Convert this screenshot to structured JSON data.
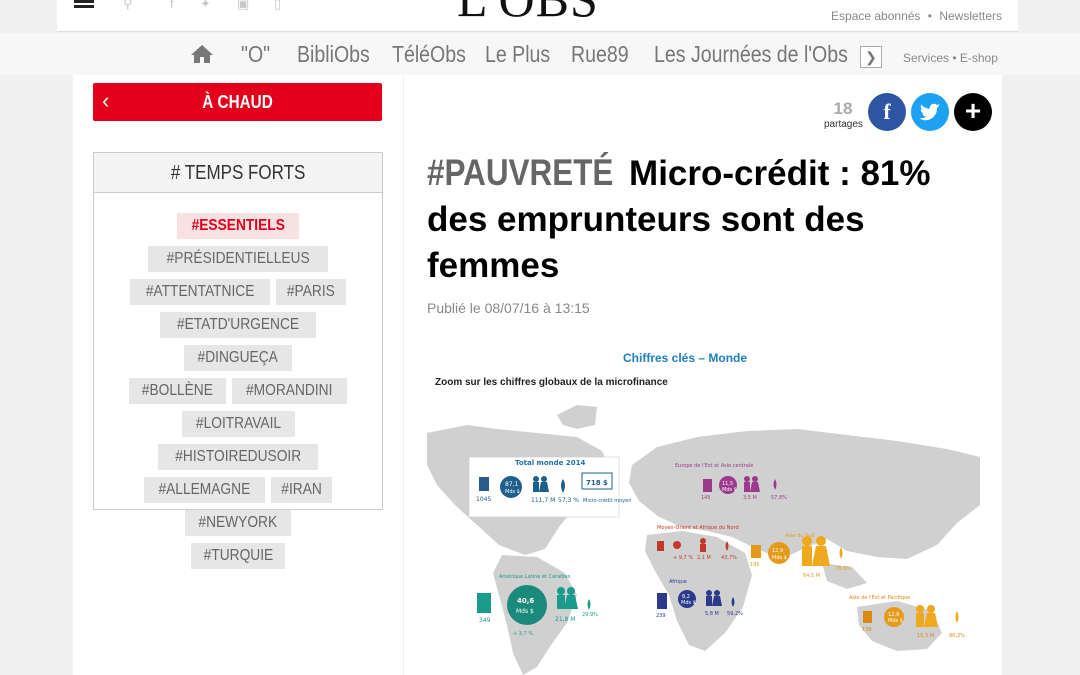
{
  "header": {
    "logo": "L'OBS",
    "links": [
      "Espace abonnés",
      "Newsletters"
    ],
    "dot": "•"
  },
  "nav": {
    "items": [
      "\"O\"",
      "BibliObs",
      "TéléObs",
      "Le Plus",
      "Rue89",
      "Les Journées de l'Obs"
    ],
    "services": "Services • E-shop"
  },
  "sidebar": {
    "hot_label": "À CHAUD",
    "temps_forts_title": "# TEMPS FORTS",
    "tags": [
      "#ESSENTIELS",
      "#PRÉSIDENTIELLEUS",
      "#ATTENTATNICE",
      "#PARIS",
      "#ETATD'URGENCE",
      "#DINGUEÇA",
      "#BOLLÈNE",
      "#MORANDINI",
      "#LOITRAVAIL",
      "#HISTOIREDUSOIR",
      "#ALLEMAGNE",
      "#IRAN",
      "#NEWYORK",
      "#TURQUIE"
    ]
  },
  "article": {
    "share_count": "18",
    "share_label": "partages",
    "category": "#PAUVRETÉ",
    "title": "Micro-crédit : 81% des emprunteurs sont des femmes",
    "published": "Publié le 08/07/16 à 13:15"
  },
  "infographic": {
    "title": "Chiffres clés – Monde",
    "subtitle": "Zoom sur les chiffres globaux de la microfinance",
    "world": {
      "label": "Total monde 2014",
      "amount": "87,1",
      "unit": "Mds $",
      "borrowers": "111,7 M",
      "women": "57,3 %",
      "loan": "718 $",
      "loan_label": "Micro-crédit moyen",
      "count": "1045"
    },
    "latam": {
      "label": "Amérique Latine et Caraïbes",
      "amount": "40,6",
      "unit": "Mds $",
      "growth": "+ 3,7 %",
      "borrowers": "21,8 M",
      "women": "29,9%",
      "count": "349"
    },
    "europe": {
      "label": "Europe de l'Est et Asie centrale",
      "amount": "11,5",
      "unit": "Mds $",
      "borrowers": "3,5 M",
      "women": "57,8%",
      "count": "145"
    },
    "mena": {
      "label": "Moyen-Orient et Afrique du Nord",
      "growth": "+ 9,7 %",
      "borrowers": "2,1 M",
      "women": "43,7%"
    },
    "south_asia": {
      "label": "Asie du Sud",
      "amount": "12,9",
      "unit": "Mds $",
      "borrowers": "64,5 M",
      "women": "78,6%",
      "count": "195"
    },
    "africa": {
      "label": "Afrique",
      "amount": "8,2",
      "unit": "Mds $",
      "borrowers": "5,8 M",
      "women": "59,2%",
      "count": "239"
    },
    "east_asia": {
      "label": "Asie de l'Est et Pacifique",
      "amount": "12,9",
      "unit": "Mds $",
      "borrowers": "15,3 M",
      "women": "80,2%",
      "count": "139"
    }
  }
}
